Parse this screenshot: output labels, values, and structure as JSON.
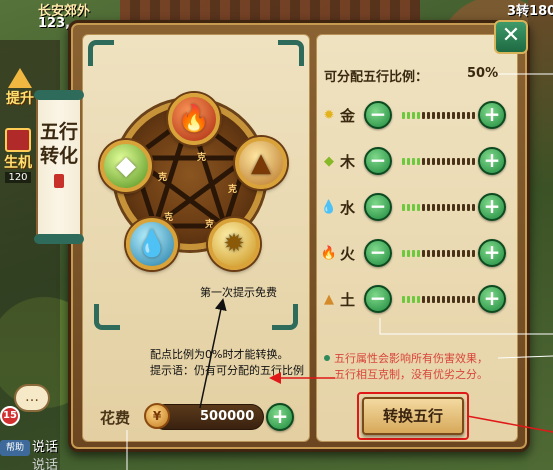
{
  "hud": {
    "location": "长安郊外",
    "coords": "123,",
    "turn": "3转180"
  },
  "side_menu": {
    "upgrade_label": "提升",
    "gift_label": "生机",
    "gift_count": "120"
  },
  "chat": {
    "badge_count": "15",
    "help_label": "帮助",
    "line1": "说话",
    "line2": "说话"
  },
  "dialog": {
    "title_lines": [
      "五行",
      "转化"
    ],
    "close_glyph": "✕"
  },
  "wheel": {
    "restrain_char": "克",
    "elements": [
      {
        "key": "fire",
        "name": "火",
        "glyph": "🔥"
      },
      {
        "key": "earth",
        "name": "土",
        "glyph": "▲"
      },
      {
        "key": "metal",
        "name": "金",
        "glyph": "✹"
      },
      {
        "key": "water",
        "name": "水",
        "glyph": "💧"
      },
      {
        "key": "wood",
        "name": "木",
        "glyph": "◆"
      }
    ]
  },
  "allocation": {
    "label": "可分配五行比例：",
    "value": "50%",
    "rows": [
      {
        "name": "金",
        "icon": "✹",
        "icon_color": "#e3b21a",
        "filled": 0.25
      },
      {
        "name": "木",
        "icon": "◆",
        "icon_color": "#86b827",
        "filled": 0.25
      },
      {
        "name": "水",
        "icon": "💧",
        "icon_color": "#2aa0cf",
        "filled": 0.25
      },
      {
        "name": "火",
        "icon": "🔥",
        "icon_color": "#e0461c",
        "filled": 0.25
      },
      {
        "name": "土",
        "icon": "▲",
        "icon_color": "#d58a2a",
        "filled": 0.25
      }
    ],
    "minus": "−",
    "plus": "+"
  },
  "info": {
    "line1": "五行属性会影响所有伤害效果，",
    "line2": "五行相互克制，没有优劣之分。"
  },
  "cost": {
    "label": "花费",
    "coin_glyph": "¥",
    "value": "500000",
    "add": "+"
  },
  "convert_button": "转换五行",
  "annotations": {
    "first_free": "第一次提示免费",
    "rule": "配点比例为0%时才能转换。",
    "hint": "提示语：仍有可分配的五行比例"
  },
  "colors": {
    "annotation_arrow": "#e01818",
    "accent_green": "#1f8a3e",
    "info_red": "#d8453a"
  }
}
